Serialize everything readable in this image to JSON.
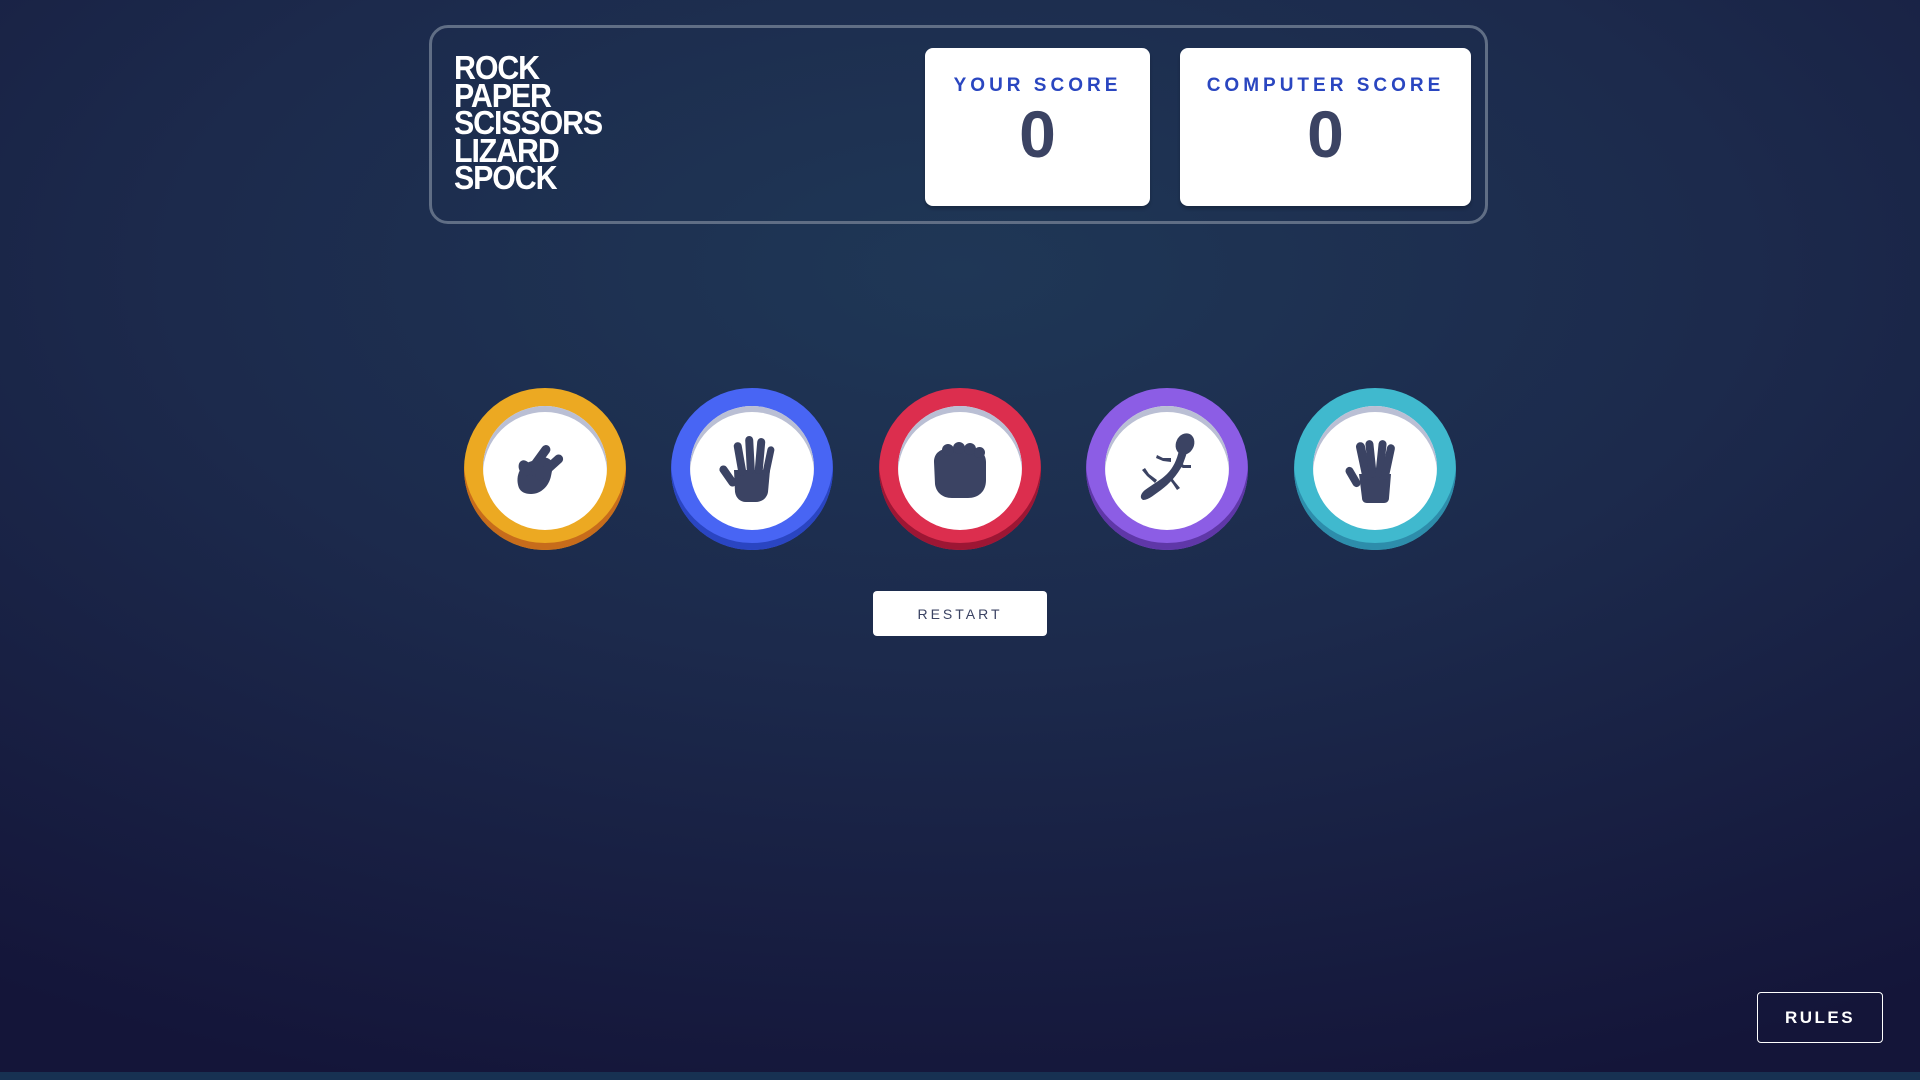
{
  "header": {
    "title_lines": [
      "ROCK",
      "PAPER",
      "SCISSORS",
      "LIZARD",
      "SPOCK"
    ],
    "your_score": {
      "label": "YOUR SCORE",
      "value": "0"
    },
    "computer_score": {
      "label": "COMPUTER SCORE",
      "value": "0"
    }
  },
  "choices": [
    {
      "id": "scissors",
      "icon": "scissors-icon",
      "color": "#eca922"
    },
    {
      "id": "paper",
      "icon": "paper-icon",
      "color": "#4865f4"
    },
    {
      "id": "rock",
      "icon": "rock-icon",
      "color": "#dc2e4e"
    },
    {
      "id": "lizard",
      "icon": "lizard-icon",
      "color": "#8c5de5"
    },
    {
      "id": "spock",
      "icon": "spock-icon",
      "color": "#40b9ce"
    }
  ],
  "controls": {
    "restart_label": "RESTART",
    "rules_label": "RULES"
  },
  "colors": {
    "icon_fill": "#3b4363",
    "score_label": "#2a46c0",
    "score_value": "#3b4363"
  }
}
